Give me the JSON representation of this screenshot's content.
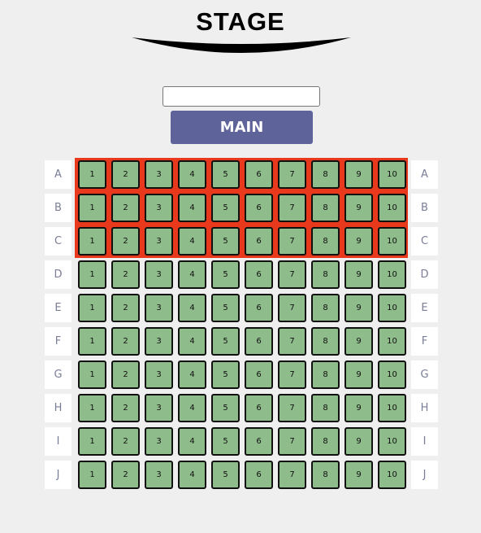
{
  "stage": {
    "title": "STAGE",
    "input_value": "",
    "button_label": "MAIN"
  },
  "colors": {
    "selection": "#e8391c",
    "seat": "#8fbc8b",
    "button": "#5e6399"
  },
  "selected_rows": [
    "A",
    "B",
    "C"
  ],
  "rows": [
    {
      "label": "A",
      "seats": [
        "1",
        "2",
        "3",
        "4",
        "5",
        "6",
        "7",
        "8",
        "9",
        "10"
      ]
    },
    {
      "label": "B",
      "seats": [
        "1",
        "2",
        "3",
        "4",
        "5",
        "6",
        "7",
        "8",
        "9",
        "10"
      ]
    },
    {
      "label": "C",
      "seats": [
        "1",
        "2",
        "3",
        "4",
        "5",
        "6",
        "7",
        "8",
        "9",
        "10"
      ]
    },
    {
      "label": "D",
      "seats": [
        "1",
        "2",
        "3",
        "4",
        "5",
        "6",
        "7",
        "8",
        "9",
        "10"
      ]
    },
    {
      "label": "E",
      "seats": [
        "1",
        "2",
        "3",
        "4",
        "5",
        "6",
        "7",
        "8",
        "9",
        "10"
      ]
    },
    {
      "label": "F",
      "seats": [
        "1",
        "2",
        "3",
        "4",
        "5",
        "6",
        "7",
        "8",
        "9",
        "10"
      ]
    },
    {
      "label": "G",
      "seats": [
        "1",
        "2",
        "3",
        "4",
        "5",
        "6",
        "7",
        "8",
        "9",
        "10"
      ]
    },
    {
      "label": "H",
      "seats": [
        "1",
        "2",
        "3",
        "4",
        "5",
        "6",
        "7",
        "8",
        "9",
        "10"
      ]
    },
    {
      "label": "I",
      "seats": [
        "1",
        "2",
        "3",
        "4",
        "5",
        "6",
        "7",
        "8",
        "9",
        "10"
      ]
    },
    {
      "label": "J",
      "seats": [
        "1",
        "2",
        "3",
        "4",
        "5",
        "6",
        "7",
        "8",
        "9",
        "10"
      ]
    }
  ]
}
